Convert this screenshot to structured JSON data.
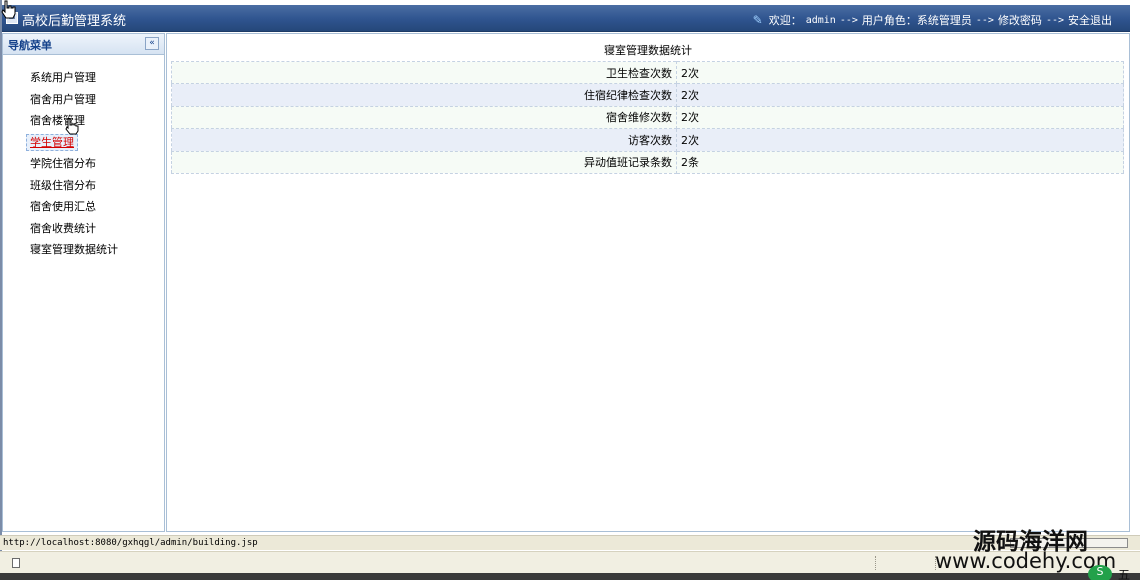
{
  "app": {
    "title": "高校后勤管理系统",
    "welcome": "欢迎：",
    "username": "admin",
    "arrow1": "-->",
    "role_label": "用户角色：系统管理员",
    "arrow2": "-->",
    "change_password": "修改密码",
    "arrow3": "-->",
    "logout": "安全退出"
  },
  "sidebar": {
    "title": "导航菜单",
    "collapse_glyph": "«",
    "items": [
      {
        "label": "系统用户管理"
      },
      {
        "label": "宿舍用户管理"
      },
      {
        "label": "宿舍楼管理"
      },
      {
        "label": "学生管理"
      },
      {
        "label": "学院住宿分布"
      },
      {
        "label": "班级住宿分布"
      },
      {
        "label": "宿舍使用汇总"
      },
      {
        "label": "宿舍收费统计"
      },
      {
        "label": "寝室管理数据统计"
      }
    ]
  },
  "main": {
    "page_title": "寝室管理数据统计",
    "rows": [
      {
        "label": "卫生检查次数",
        "value": "2次"
      },
      {
        "label": "住宿纪律检查次数",
        "value": "2次"
      },
      {
        "label": "宿舍维修次数",
        "value": "2次"
      },
      {
        "label": "访客次数",
        "value": "2次"
      },
      {
        "label": "异动值班记录条数",
        "value": "2条"
      }
    ]
  },
  "status_bar": {
    "url": "http://localhost:8080/gxhqgl/admin/building.jsp"
  },
  "watermark": {
    "cn": "源码海洋网",
    "url": "www.codehy.com",
    "logo_glyph": "S",
    "extra_char": "五"
  }
}
